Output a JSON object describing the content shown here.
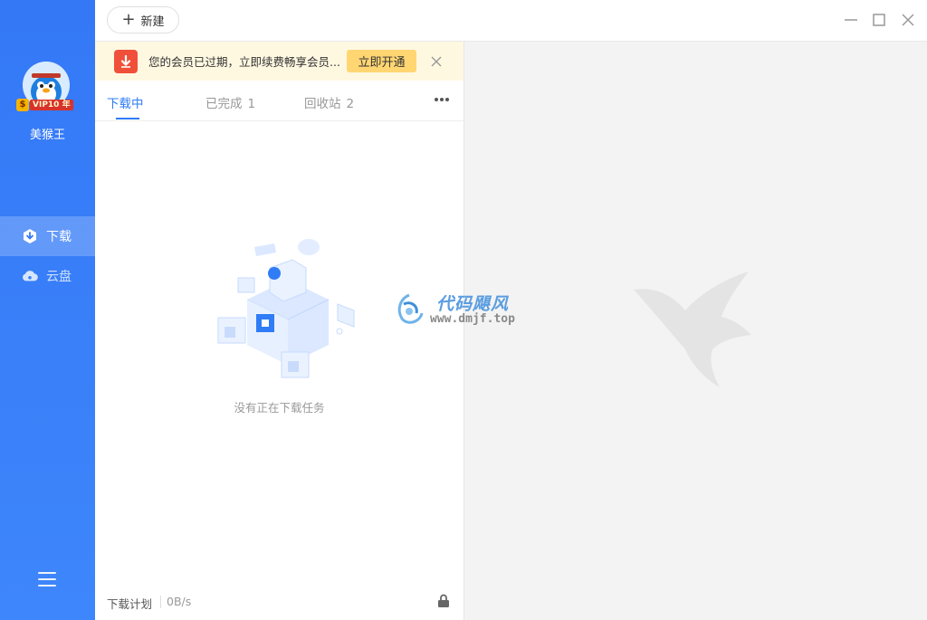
{
  "sidebar": {
    "username": "美猴王",
    "vip_badge": "VIP10 年",
    "nav": [
      {
        "label": "下载",
        "icon": "download-hex-icon",
        "active": true
      },
      {
        "label": "云盘",
        "icon": "cloud-icon",
        "active": false
      }
    ],
    "menu_icon": "menu-icon"
  },
  "topbar": {
    "new_label": "新建",
    "controls": [
      "minimize-icon",
      "maximize-icon",
      "close-icon"
    ]
  },
  "banner": {
    "text": "您的会员已过期，立即续费畅享会员...",
    "button": "立即开通"
  },
  "tabs": [
    {
      "label": "下载中",
      "count": "",
      "active": true
    },
    {
      "label": "已完成",
      "count": "1",
      "active": false
    },
    {
      "label": "回收站",
      "count": "2",
      "active": false
    }
  ],
  "empty_text": "没有正在下载任务",
  "footer": {
    "plan_label": "下载计划",
    "speed": "0B/s"
  },
  "watermark": {
    "title": "代码飓风",
    "url": "www.dmjf.top"
  },
  "colors": {
    "sidebar": "#3478f6",
    "accent": "#2f7cf6",
    "banner_bg": "#fff8e1",
    "banner_button": "#ffd672"
  }
}
